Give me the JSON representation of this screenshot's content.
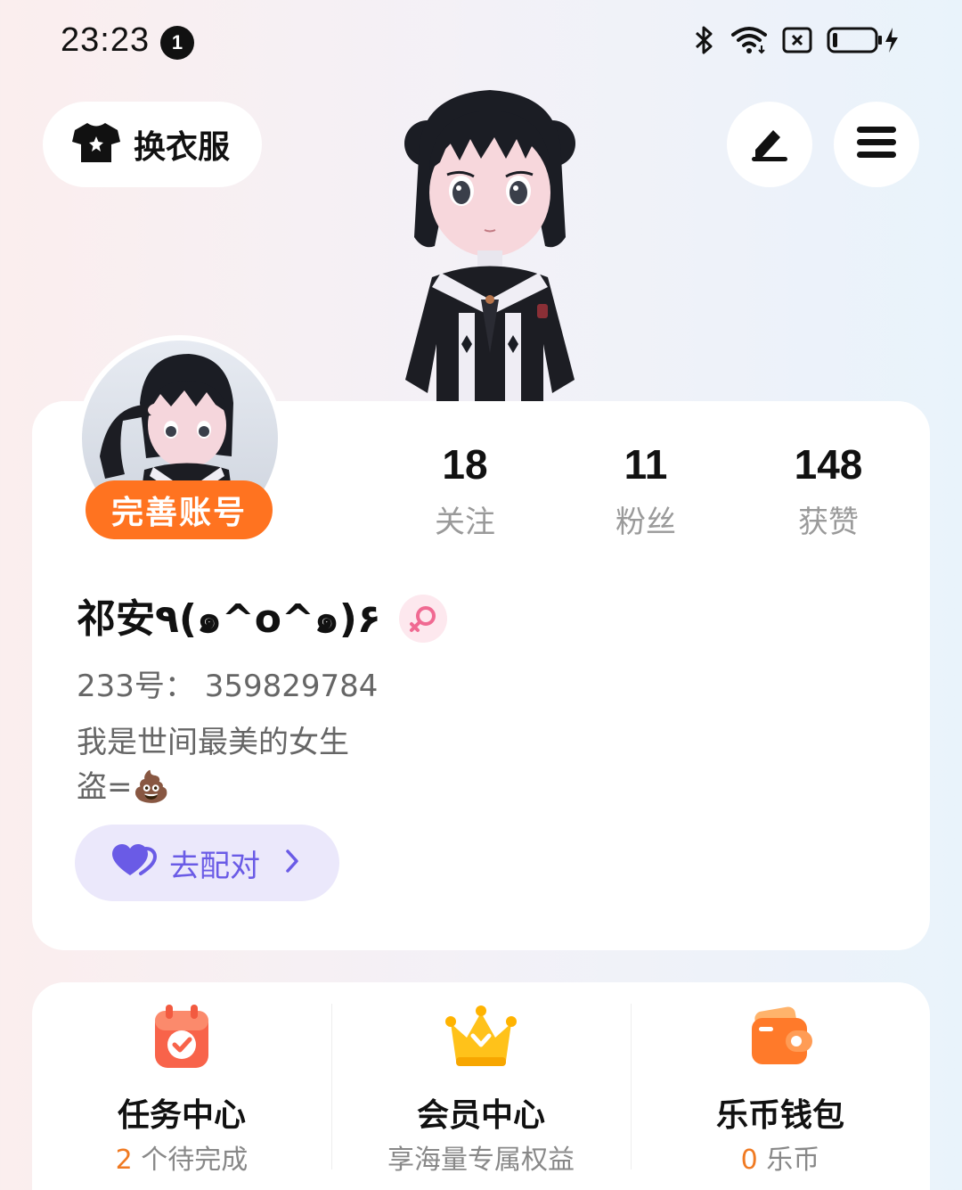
{
  "status_bar": {
    "time": "23:23",
    "notification_count": "1"
  },
  "header": {
    "outfit_label": "换衣服",
    "edit_icon": "pencil-icon",
    "menu_icon": "hamburger-menu-icon"
  },
  "profile": {
    "complete_account_label": "完善账号",
    "username": "祁安٩(๑^o^๑)۶",
    "gender_icon": "female-icon",
    "account_id": "233号：  359829784",
    "bio_line1": "我是世间最美的女生",
    "bio_line2_text": "盗=",
    "bio_line2_emoji": "💩",
    "match_label": "去配对",
    "stats": [
      {
        "value": "18",
        "label": "关注"
      },
      {
        "value": "11",
        "label": "粉丝"
      },
      {
        "value": "148",
        "label": "获赞"
      }
    ]
  },
  "features": [
    {
      "title": "任务中心",
      "sub_accent": "2",
      "sub_text": " 个待完成",
      "icon": "calendar-check-icon"
    },
    {
      "title": "会员中心",
      "sub_accent": "",
      "sub_text": "享海量专属权益",
      "icon": "crown-icon"
    },
    {
      "title": "乐币钱包",
      "sub_accent": "0",
      "sub_text": " 乐币",
      "icon": "wallet-icon"
    }
  ],
  "colors": {
    "accent_orange": "#ff7320",
    "match_purple": "#6a5be6",
    "female_pink": "#f06a92"
  }
}
